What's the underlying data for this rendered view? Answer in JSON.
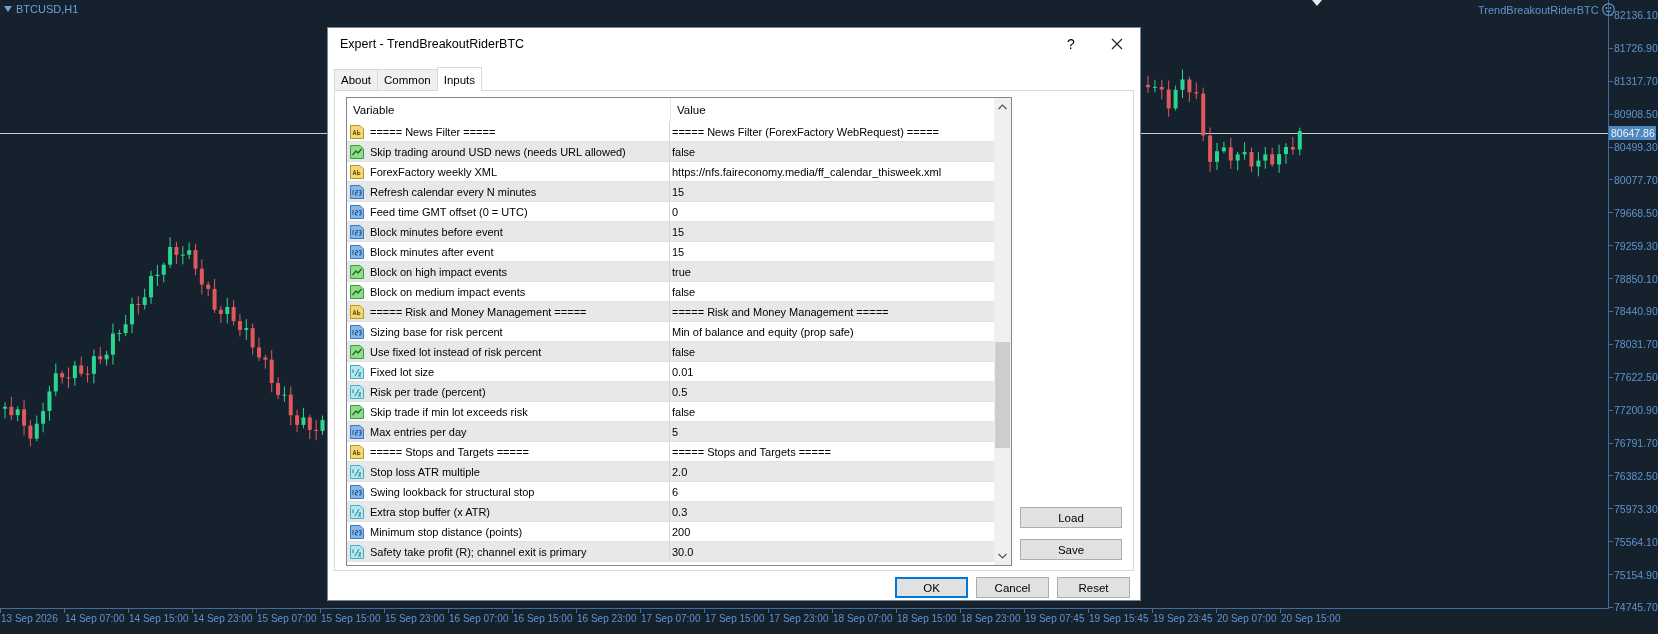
{
  "chart": {
    "symbol": "BTCUSD,H1",
    "expert": "TrendBreakoutRiderBTC",
    "price_labels": [
      "82136.10",
      "81726.90",
      "81317.70",
      "80908.50",
      "80499.30",
      "80077.70",
      "79668.50",
      "79259.30",
      "78850.10",
      "78440.90",
      "78031.70",
      "77622.50",
      "77200.90",
      "76791.70",
      "76382.50",
      "75973.30",
      "75564.10",
      "75154.90",
      "74745.70"
    ],
    "current_price": "80647.86",
    "time_labels": [
      "13 Sep 2026",
      "14 Sep 07:00",
      "14 Sep 15:00",
      "14 Sep 23:00",
      "15 Sep 07:00",
      "15 Sep 15:00",
      "15 Sep 23:00",
      "16 Sep 07:00",
      "16 Sep 15:00",
      "16 Sep 23:00",
      "17 Sep 07:00",
      "17 Sep 15:00",
      "17 Sep 23:00",
      "18 Sep 07:00",
      "18 Sep 15:00",
      "18 Sep 23:00",
      "19 Sep 07:45",
      "19 Sep 15:45",
      "19 Sep 23:45",
      "20 Sep 07:00",
      "20 Sep 15:00"
    ]
  },
  "dialog": {
    "title": "Expert - TrendBreakoutRiderBTC",
    "help": "?",
    "tabs": [
      {
        "label": "About",
        "selected": false
      },
      {
        "label": "Common",
        "selected": false
      },
      {
        "label": "Inputs",
        "selected": true
      }
    ],
    "columns": [
      "Variable",
      "Value"
    ],
    "rows": [
      {
        "kind": "string",
        "variable": "===== News Filter =====",
        "value": "===== News Filter (ForexFactory WebRequest) ====="
      },
      {
        "kind": "bool",
        "variable": "Skip trading around USD news (needs URL allowed)",
        "value": "false"
      },
      {
        "kind": "string",
        "variable": "ForexFactory weekly XML",
        "value": "https://nfs.faireconomy.media/ff_calendar_thisweek.xml"
      },
      {
        "kind": "int",
        "variable": "Refresh calendar every N minutes",
        "value": "15"
      },
      {
        "kind": "int",
        "variable": "Feed time GMT offset (0 = UTC)",
        "value": "0"
      },
      {
        "kind": "int",
        "variable": "Block minutes before event",
        "value": "15"
      },
      {
        "kind": "int",
        "variable": "Block minutes after event",
        "value": "15"
      },
      {
        "kind": "bool",
        "variable": "Block on high impact events",
        "value": "true"
      },
      {
        "kind": "bool",
        "variable": "Block on medium impact events",
        "value": "false"
      },
      {
        "kind": "string",
        "variable": "===== Risk and Money Management =====",
        "value": "===== Risk and Money Management ====="
      },
      {
        "kind": "int",
        "variable": "Sizing base for risk percent",
        "value": "Min of balance and equity (prop safe)"
      },
      {
        "kind": "bool",
        "variable": "Use fixed lot instead of risk percent",
        "value": "false"
      },
      {
        "kind": "double",
        "variable": "Fixed lot size",
        "value": "0.01"
      },
      {
        "kind": "double",
        "variable": "Risk per trade (percent)",
        "value": "0.5"
      },
      {
        "kind": "bool",
        "variable": "Skip trade if min lot exceeds risk",
        "value": "false"
      },
      {
        "kind": "int",
        "variable": "Max entries per day",
        "value": "5"
      },
      {
        "kind": "string",
        "variable": "===== Stops and Targets =====",
        "value": "===== Stops and Targets ====="
      },
      {
        "kind": "double",
        "variable": "Stop loss ATR multiple",
        "value": "2.0"
      },
      {
        "kind": "int",
        "variable": "Swing lookback for structural stop",
        "value": "6"
      },
      {
        "kind": "double",
        "variable": "Extra stop buffer (x ATR)",
        "value": "0.3"
      },
      {
        "kind": "int",
        "variable": "Minimum stop distance (points)",
        "value": "200"
      },
      {
        "kind": "double",
        "variable": "Safety take profit (R); channel exit is primary",
        "value": "30.0"
      }
    ],
    "side_buttons": [
      "Load",
      "Save"
    ],
    "buttons": [
      {
        "label": "OK",
        "default": true
      },
      {
        "label": "Cancel",
        "default": false
      },
      {
        "label": "Reset",
        "default": false
      }
    ]
  }
}
